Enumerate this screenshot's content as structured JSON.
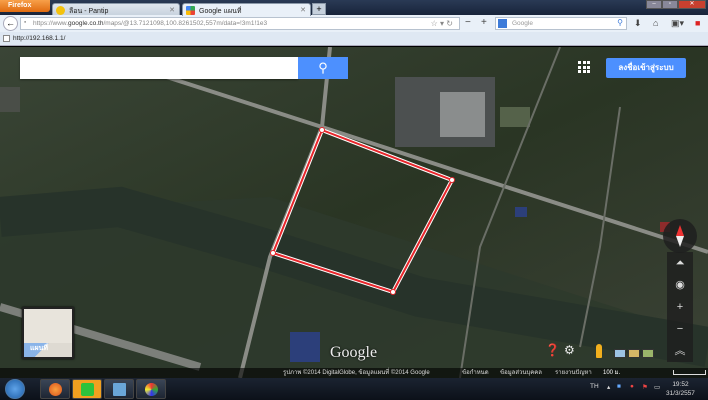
{
  "browser": {
    "menu_button": "Firefox",
    "tabs": [
      {
        "label": "ลือน - Pantip",
        "active": false
      },
      {
        "label": "Google แผนที่",
        "active": true
      }
    ],
    "url_prefix": "https://www.",
    "url_domain": "google.co.th",
    "url_rest": "/maps/@13.7121098,100.8261502,557m/data=!3m1!1e3",
    "search_placeholder": "Google",
    "bookmark": "http://192.168.1.1/"
  },
  "map": {
    "search_placeholder": "",
    "search_icon": "magnifier-icon",
    "signin_label": "ลงชื่อเข้าสู่ระบบ",
    "minimap_label": "แผนที่",
    "logo": "Google",
    "attribution": "รูปภาพ ©2014 DigitalGlobe, ข้อมูลแผนที่ ©2014 Google",
    "terms": "ข้อกำหนด",
    "privacy": "ข้อมูลส่วนบุคคล",
    "report": "รายงานปัญหา",
    "scale": "100 ม.",
    "polygon_color": "#e8262b",
    "accent": "#4d90fe"
  },
  "taskbar": {
    "lang": "TH",
    "time": "19:52",
    "date": "31/3/2557"
  }
}
